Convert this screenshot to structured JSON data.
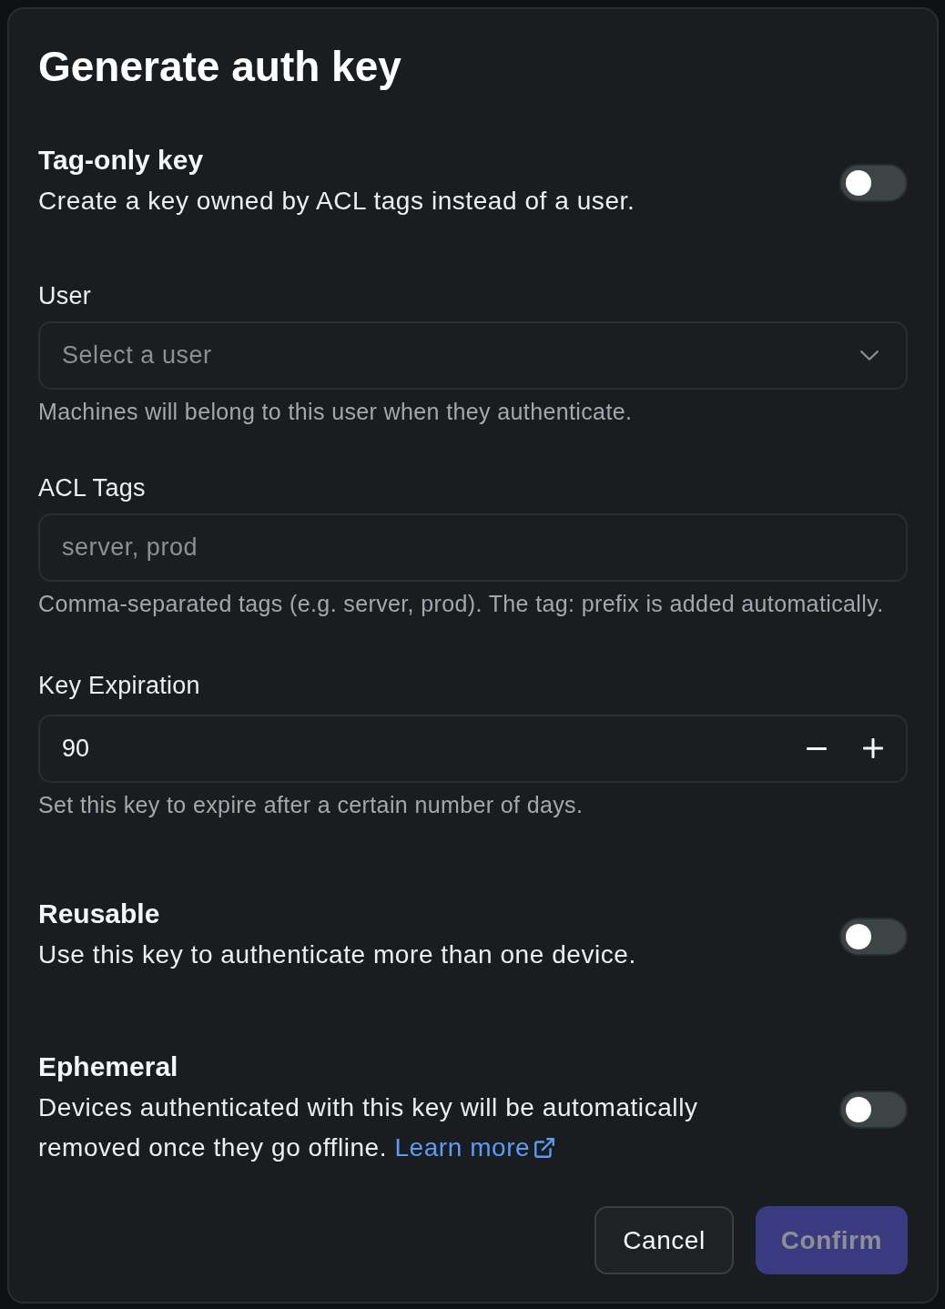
{
  "dialog": {
    "title": "Generate auth key"
  },
  "sections": [
    {
      "kind": "toggle",
      "label": "Tag-only key",
      "description": "Create a key owned by ACL tags instead of a user.",
      "on": false
    },
    {
      "kind": "select",
      "label": "User",
      "placeholder": "Select a user",
      "help": "Machines will belong to this user when they authenticate."
    },
    {
      "kind": "text",
      "label": "ACL Tags",
      "placeholder": "server, prod",
      "help": "Comma-separated tags (e.g. server, prod). The tag: prefix is added automatically."
    },
    {
      "kind": "number",
      "label": "Key Expiration",
      "value": "90",
      "help": "Set this key to expire after a certain number of days."
    },
    {
      "kind": "toggle",
      "label": "Reusable",
      "description": "Use this key to authenticate more than one device.",
      "on": false
    },
    {
      "kind": "toggle",
      "label": "Ephemeral",
      "description": "Devices authenticated with this key will be automatically removed once they go offline.",
      "link": "Learn more",
      "on": false
    }
  ],
  "buttons": [
    {
      "kind": "secondary",
      "label": "Cancel",
      "disabled": false
    },
    {
      "kind": "primary",
      "label": "Confirm",
      "disabled": true
    }
  ]
}
